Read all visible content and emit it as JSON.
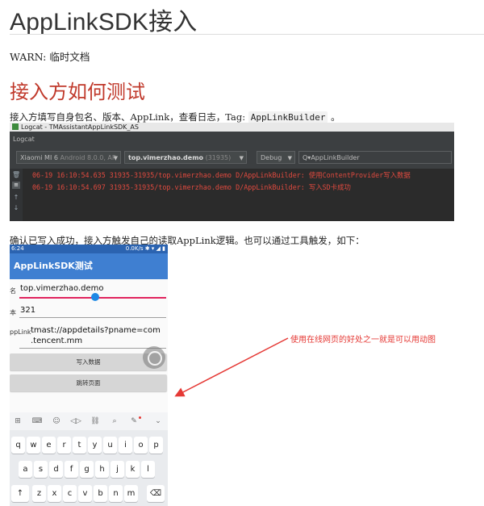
{
  "title": "AppLinkSDK接入",
  "warn": "WARN: 临时文档",
  "section_heading": "接入方如何测试",
  "intro": {
    "text": "接入方填写自身包名、版本、AppLink，查看日志，Tag: ",
    "tag": "AppLinkBuilder",
    "end": " 。"
  },
  "logcat": {
    "window_title": "Logcat - TMAssistantAppLinkSDK_AS",
    "tab": "Logcat",
    "device": {
      "name": "Xiaomi MI 6",
      "os": "Android 8.0.0, AP"
    },
    "process": {
      "name": "top.vimerzhao.demo",
      "pid": "(31935)"
    },
    "level": "Debug",
    "search": "AppLinkBuilder",
    "search_prefix": "Q▾",
    "lines": [
      "06-19 16:10:54.635 31935-31935/top.vimerzhao.demo D/AppLinkBuilder: 使用ContentProvider写入数据",
      "06-19 16:10:54.697 31935-31935/top.vimerzhao.demo D/AppLinkBuilder: 写入SD卡成功"
    ],
    "gutter_icons": [
      "trash-icon",
      "soft-wrap-icon",
      "arrow-up-icon",
      "arrow-down-icon"
    ]
  },
  "paragraph2": "确认已写入成功，接入方触发自己的读取AppLink逻辑。也可以通过工具触发，如下：",
  "phone": {
    "status_time": "6:24",
    "status_right": "0.0K/s ✱ ▾ ◢ ▮",
    "app_title": "AppLinkSDK测试",
    "fields": [
      {
        "label": "名",
        "value": "top.vimerzhao.demo"
      },
      {
        "label": "本",
        "value": "321"
      },
      {
        "label": "ppLink",
        "value_line1": "tmast://appdetails?pname=com",
        "value_line2": ".tencent.mm"
      }
    ],
    "buttons": [
      "写入数据",
      "跳转页面"
    ],
    "toolbar_glyphs": [
      "⊞",
      "⌨",
      "☺",
      "◁▷",
      "⛓",
      "⌕",
      "✎",
      "⌄"
    ],
    "keyboard_rows": [
      [
        "q",
        "w",
        "e",
        "r",
        "t",
        "y",
        "u",
        "i",
        "o",
        "p"
      ],
      [
        "a",
        "s",
        "d",
        "f",
        "g",
        "h",
        "j",
        "k",
        "l"
      ],
      [
        "↑",
        "z",
        "x",
        "c",
        "v",
        "b",
        "n",
        "m",
        "⌫"
      ]
    ]
  },
  "annotation": "使用在线网页的好处之一就是可以用动图",
  "colors": {
    "heading": "#c0392b",
    "annotation": "#e53935",
    "app_bar": "#3f7fd1",
    "log_text": "#e04a3f"
  }
}
